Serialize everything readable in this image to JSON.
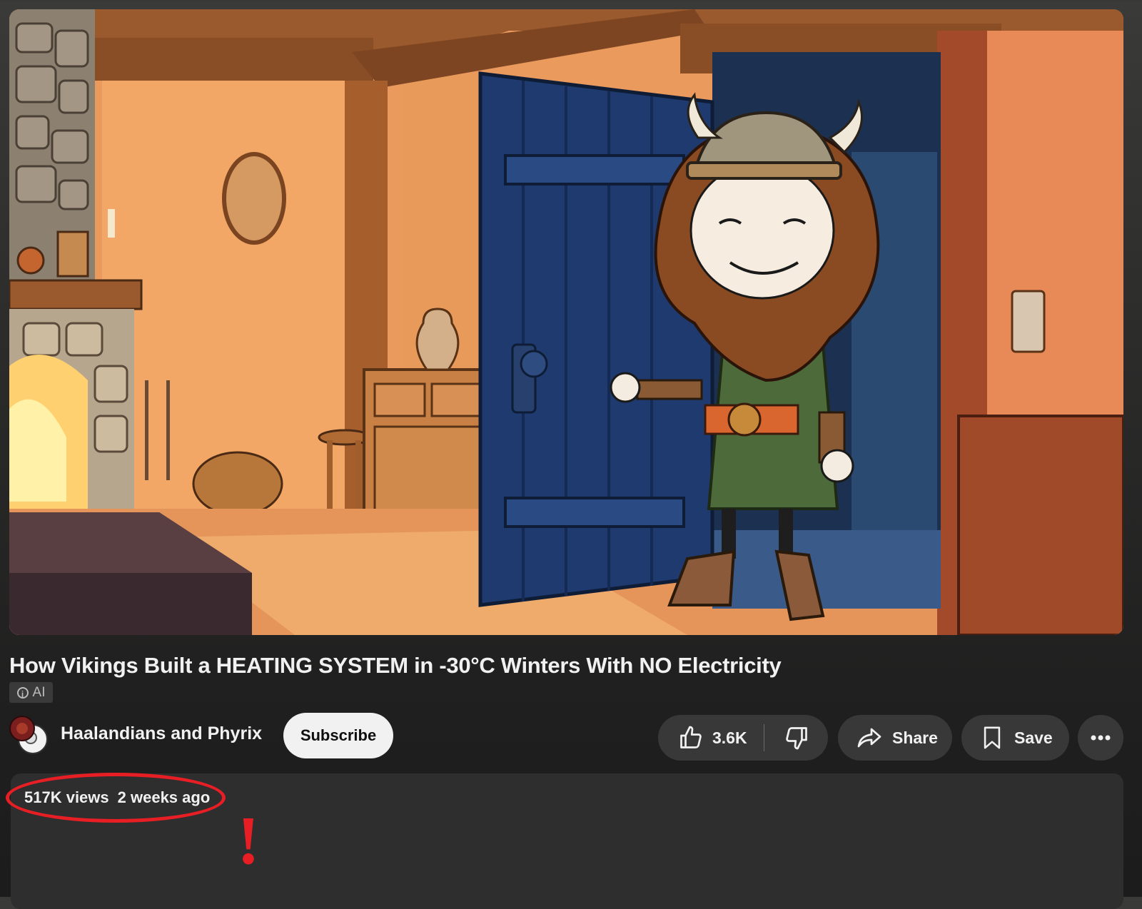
{
  "video": {
    "title": "How Vikings Built a HEATING SYSTEM in -30°C Winters With NO Electricity",
    "ai_label": "AI"
  },
  "channel": {
    "name": "Haalandians and Phyrix",
    "subscribe_label": "Subscribe"
  },
  "actions": {
    "like_count": "3.6K",
    "share_label": "Share",
    "save_label": "Save"
  },
  "description": {
    "views": "517K views",
    "date": "2 weeks ago"
  },
  "annotation": {
    "mark": "!",
    "color": "#e81e25"
  },
  "icons": [
    "info-icon",
    "thumbs-up-icon",
    "thumbs-down-icon",
    "share-arrow-icon",
    "bookmark-icon",
    "more-horizontal-icon"
  ]
}
